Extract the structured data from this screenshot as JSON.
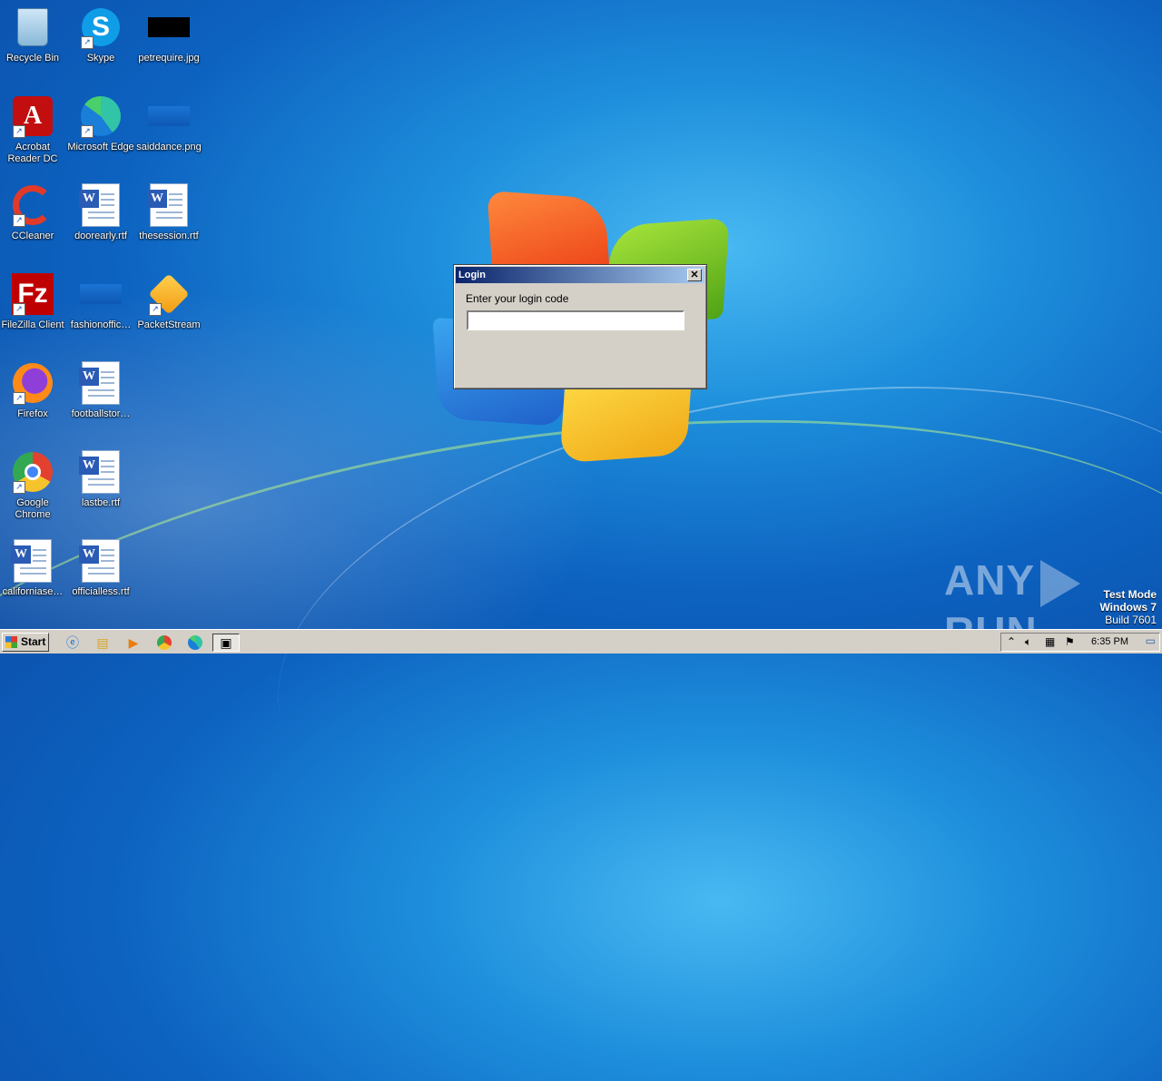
{
  "desktop": {
    "icons": [
      {
        "label": "Recycle Bin",
        "icon": "recycle-bin-icon"
      },
      {
        "label": "Skype",
        "icon": "skype-icon"
      },
      {
        "label": "petrequire.jpg",
        "icon": "image-file-icon"
      },
      {
        "label": "Acrobat Reader DC",
        "icon": "acrobat-icon"
      },
      {
        "label": "Microsoft Edge",
        "icon": "edge-icon"
      },
      {
        "label": "saiddance.png",
        "icon": "image-file-icon"
      },
      {
        "label": "CCleaner",
        "icon": "ccleaner-icon"
      },
      {
        "label": "doorearly.rtf",
        "icon": "word-doc-icon"
      },
      {
        "label": "thesession.rtf",
        "icon": "word-doc-icon"
      },
      {
        "label": "FileZilla Client",
        "icon": "filezilla-icon"
      },
      {
        "label": "fashionoffic…",
        "icon": "image-file-icon"
      },
      {
        "label": "PacketStream",
        "icon": "packetstream-icon"
      },
      {
        "label": "Firefox",
        "icon": "firefox-icon"
      },
      {
        "label": "footballstor…",
        "icon": "word-doc-icon"
      },
      {
        "label": "Google Chrome",
        "icon": "chrome-icon"
      },
      {
        "label": "lastbe.rtf",
        "icon": "word-doc-icon"
      },
      {
        "label": "californiase…",
        "icon": "word-doc-icon"
      },
      {
        "label": "officialless.rtf",
        "icon": "word-doc-icon"
      }
    ]
  },
  "dialog": {
    "title": "Login",
    "close_label": "✕",
    "prompt": "Enter your login code",
    "input_value": "",
    "input_placeholder": ""
  },
  "watermark": {
    "brand_left": "ANY",
    "brand_right": "RUN",
    "line1": "Test Mode",
    "line2": "Windows 7",
    "line3": "Build 7601"
  },
  "taskbar": {
    "start_label": "Start",
    "pinned": [
      "internet-explorer-icon",
      "file-explorer-icon",
      "media-player-icon",
      "chrome-icon",
      "edge-icon",
      "login-app-icon"
    ],
    "clock": "6:35 PM"
  }
}
